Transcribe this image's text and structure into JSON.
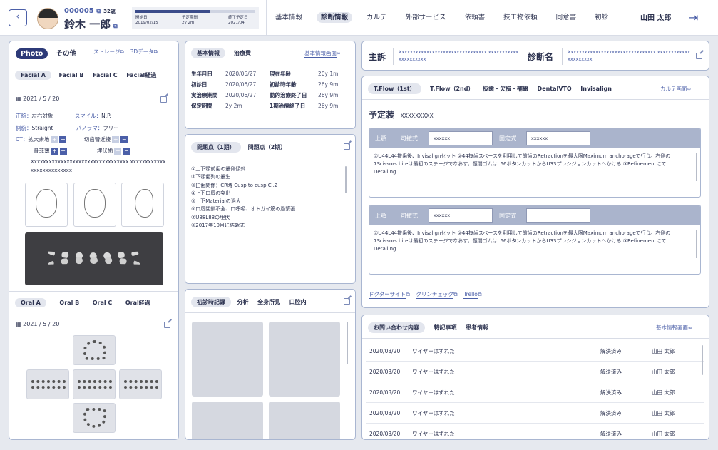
{
  "header": {
    "patient_id": "000005",
    "age": "32歳",
    "name": "鈴木 一郎",
    "start_label": "開始日",
    "start_date": "2019/02/15",
    "period_label": "予定期間",
    "period_value": "2y 2m",
    "end_label": "終了予定日",
    "end_date": "2021/04",
    "progress": 0.62,
    "nav": [
      "基本情報",
      "診断情報",
      "カルテ",
      "外部サービス",
      "依頼書",
      "技工物依頼",
      "同意書",
      "初診"
    ],
    "active_nav": 1,
    "user": "山田 太郎"
  },
  "left": {
    "tabs": [
      "Photo",
      "その他"
    ],
    "links": [
      "ストレージ",
      "3Dデータ"
    ],
    "facial_tabs": [
      "Facial A",
      "Facial B",
      "Facial C",
      "Facial経過"
    ],
    "facial_date": "2021 / 5 / 20",
    "items": {
      "front_label": "正貌：",
      "front_value": "左右対象",
      "smile_label": "スマイル：",
      "smile_value": "N.P.",
      "side_label": "側貌：",
      "side_value": "Straight",
      "pano_label": "パノラマ：",
      "pano_value": "フリー",
      "ct_label": "CT：",
      "ct_1": "拡大余地",
      "ct_2": "切歯管近接",
      "ct_3": "骨菲薄",
      "ct_4": "埋伏歯"
    },
    "note": "Xxxxxxxxxxxxxxxxxxxxxxxxxxxxxxxxx xxxxxxxxxxxxxxxxxxxxxxxxxx",
    "oral_tabs": [
      "Oral A",
      "Oral B",
      "Oral C",
      "Oral経過"
    ],
    "oral_date": "2021 / 5 / 20"
  },
  "basic": {
    "tabs": [
      "基本情報",
      "治療費"
    ],
    "link": "基本情報画面",
    "rows": [
      [
        "生年月日",
        "2020/06/27",
        "現在年齢",
        "20y 1m"
      ],
      [
        "初診日",
        "2020/06/27",
        "初診時年齢",
        "26y 9m"
      ],
      [
        "実治療期間",
        "2020/06/27",
        "動的治療終了日",
        "26y 9m"
      ],
      [
        "保定期間",
        "2y 2m",
        "1期治療終了日",
        "26y 9m"
      ]
    ]
  },
  "problems": {
    "tabs": [
      "問題点（1期）",
      "問題点（2期）"
    ],
    "items": [
      "①上下顎前歯の叢側傾斜",
      "②下顎歯列の叢生",
      "③臼歯関係：CR時 Cusp to cusp Cl.2",
      "④上下口唇の突出",
      "⑤上下Materialの過大",
      "⑥口唇閉鎖不全、口呼吸、オトガイ筋の過緊張",
      "⑦U88L88の埋伏",
      "⑧2017年10月に結紮式"
    ]
  },
  "initial": {
    "tabs": [
      "初診時記録",
      "分析",
      "全身所見",
      "口腔内"
    ]
  },
  "diag": {
    "main_label": "主訴",
    "main_value": "Xxxxxxxxxxxxxxxxxxxxxxxxxxxxxxxx xxxxxxxxxxxxxxxxxxxxx",
    "name_label": "診断名",
    "name_value": "Xxxxxxxxxxxxxxxxxxxxxxxxxxxxxxxx xxxxxxxxxxxxxxxxxxxxx"
  },
  "tflow": {
    "tabs": [
      "T.Flow（1st）",
      "T.Flow（2nd）",
      "抜歯・欠損・補綴",
      "DentalVTO",
      "Invisalign"
    ],
    "link": "カルテ画面",
    "plan_label": "予定装",
    "plan_value": "XXXXXXXXX",
    "cards": [
      {
        "jaw": "上顎",
        "mov": "可撤式",
        "mov_val": "xxxxxx",
        "fix": "固定式",
        "fix_val": "xxxxxx",
        "text": "①U44L44抜歯後、Invisalignセット ②44抜歯スペースを利用して前歯のRetractionを最大限Maximum anchorageで行う。右側の7Scissors biteは最初のステージでなおす。顎間ゴムはL66ボタンカットからU33プレシジョンカットへかける ③RefinementにてDetailing"
      },
      {
        "jaw": "上顎",
        "mov": "可撤式",
        "mov_val": "xxxxxx",
        "fix": "固定式",
        "fix_val": "",
        "text": "①U44L44抜歯後、Invisalignセット ②44抜歯スペースを利用して前歯のRetractionを最大限Maximum anchorageで行う。右側の7Scissors biteは最初のステージでなおす。顎間ゴムはL66ボタンカットからU33プレシジョンカットへかける ③RefinementにてDetailing"
      }
    ],
    "links": [
      "ドクターサイト",
      "クリンチェック",
      "Trello"
    ]
  },
  "inq": {
    "tabs": [
      "お問い合わせ内容",
      "特記事項",
      "患者情報"
    ],
    "link": "基本情報画面",
    "rows": [
      [
        "2020/03/20",
        "ワイヤーはずれた",
        "解決済み",
        "山田 太郎"
      ],
      [
        "2020/03/20",
        "ワイヤーはずれた",
        "解決済み",
        "山田 太郎"
      ],
      [
        "2020/03/20",
        "ワイヤーはずれた",
        "解決済み",
        "山田 太郎"
      ],
      [
        "2020/03/20",
        "ワイヤーはずれた",
        "解決済み",
        "山田 太郎"
      ],
      [
        "2020/03/20",
        "ワイヤーはずれた",
        "解決済み",
        "山田 太郎"
      ]
    ]
  }
}
